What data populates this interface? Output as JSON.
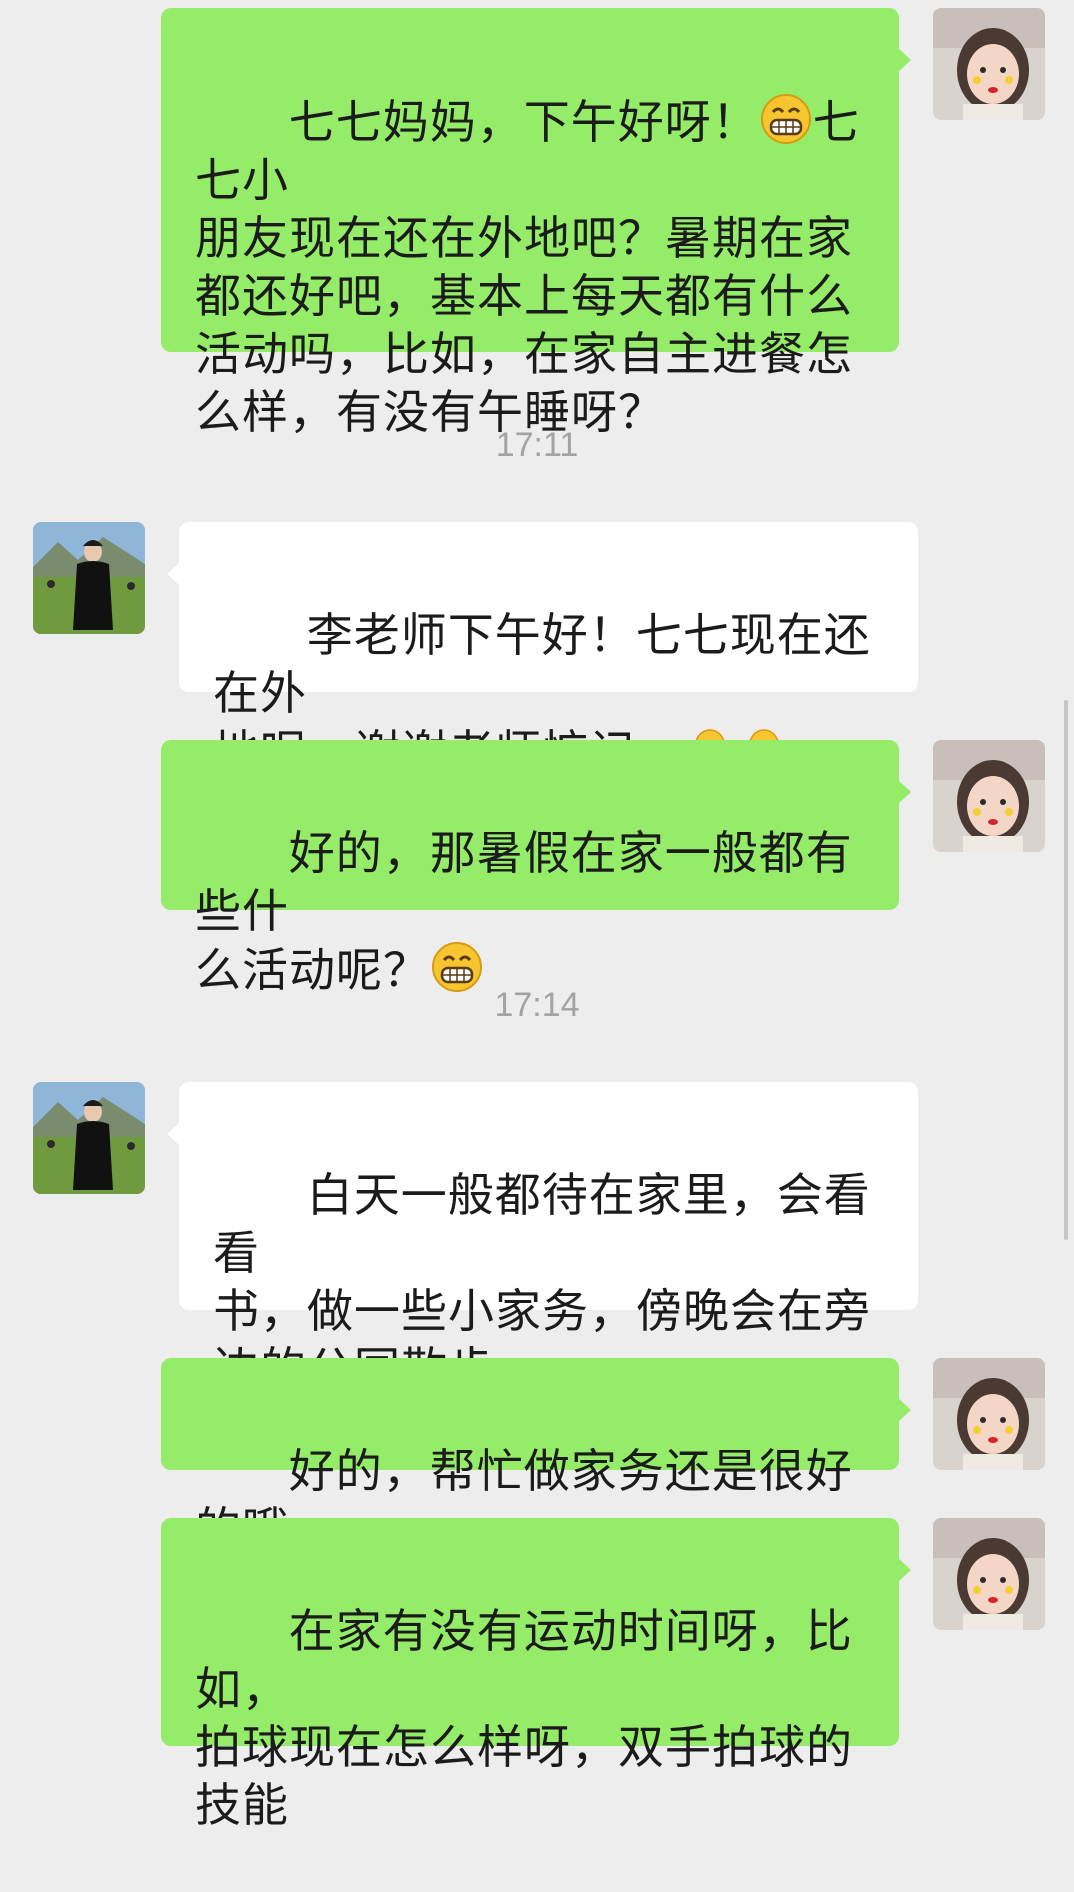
{
  "messages": [
    {
      "sender": "me",
      "parts": [
        "七七妈妈，下午好呀！",
        "{grin-emoji}",
        "七七小\n朋友现在还在外地吧？暑期在家\n都还好吧，基本上每天都有什么\n活动吗，比如，在家自主进餐怎\n么样，有没有午睡呀？"
      ]
    },
    {
      "sender": "other",
      "parts": [
        "李老师下午好！七七现在还在外\n地呢，谢谢老师惦记。",
        "{shy-emoji}",
        "{shy-emoji}"
      ]
    },
    {
      "sender": "me",
      "parts": [
        "好的，那暑假在家一般都有些什\n么活动呢？",
        "{grin-emoji}"
      ]
    },
    {
      "sender": "other",
      "parts": [
        "白天一般都待在家里，会看看\n书，做一些小家务，傍晚会在旁\n边的公园散步。"
      ]
    },
    {
      "sender": "me",
      "parts": [
        "好的，帮忙做家务还是很好的哦"
      ]
    },
    {
      "sender": "me",
      "parts": [
        "在家有没有运动时间呀，比如，\n拍球现在怎么样呀，双手拍球的\n技能"
      ]
    }
  ],
  "timestamps": [
    "17:11",
    "17:14"
  ],
  "colors": {
    "background": "#ededed",
    "my_bubble": "#95ec69",
    "other_bubble": "#ffffff",
    "timestamp_text": "#a3a3a3"
  },
  "icons": {
    "grin": "grin-emoji",
    "shy": "shy-emoji",
    "teacher_avatar": "teacher-avatar",
    "parent_avatar": "parent-avatar"
  }
}
